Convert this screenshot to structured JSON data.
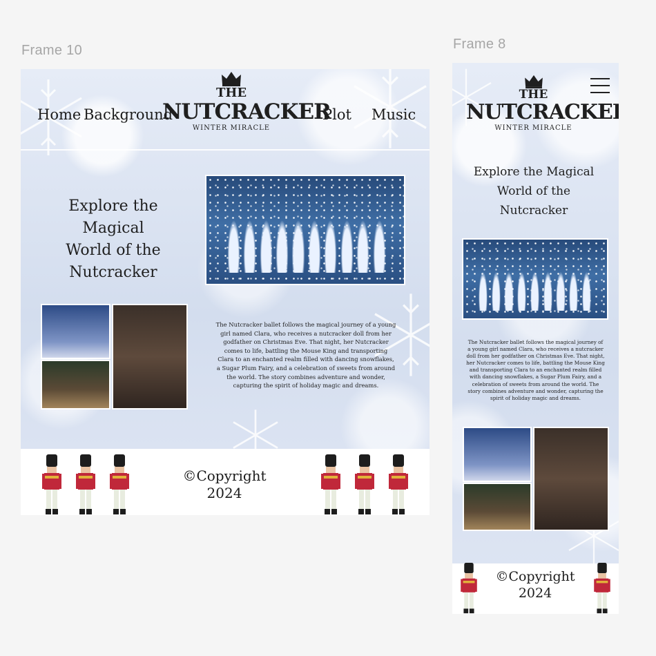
{
  "frames": {
    "desktop": {
      "label": "Frame 10"
    },
    "mobile": {
      "label": "Frame 8"
    }
  },
  "nav": {
    "home": "Home",
    "background": "Background",
    "plot": "Plot",
    "music": "Music"
  },
  "logo": {
    "the": "THE",
    "title": "NUTCRACKER",
    "subtitle": "WINTER MIRACLE"
  },
  "headline": {
    "line1": "Explore the Magical",
    "line2": "World of the",
    "line3": "Nutcracker"
  },
  "description": "The Nutcracker ballet follows the magical journey of a young girl named Clara, who receives a nutcracker doll from her godfather on Christmas Eve. That night, her Nutcracker comes to life, battling the Mouse King and transporting Clara to an enchanted realm filled with dancing snowflakes, a Sugar Plum Fairy, and a celebration of sweets from around the world. The story combines adventure and wonder, capturing the spirit of holiday magic and dreams.",
  "footer": {
    "copyright_symbol": "©",
    "copyright_word": "Copyright",
    "year": "2024"
  },
  "icons": [
    "crown-icon",
    "snowflake-icon",
    "nutcracker-soldier-icon",
    "hamburger-menu-icon"
  ],
  "colors": {
    "canvas": "#f5f5f5",
    "frame_bg": "#d9e2f1",
    "text": "#1f1f1f",
    "footer_bg": "#ffffff",
    "soldier_red": "#c0283a"
  }
}
